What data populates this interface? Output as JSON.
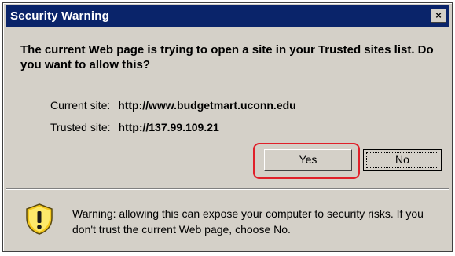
{
  "window": {
    "title": "Security Warning",
    "close_glyph": "×"
  },
  "dialog": {
    "question": "The current Web page is trying to open a site in your Trusted sites list. Do you want to allow this?",
    "current_site_label": "Current site:",
    "current_site_value": "http://www.budgetmart.uconn.edu",
    "trusted_site_label": "Trusted site:",
    "trusted_site_value": "http://137.99.109.21"
  },
  "buttons": {
    "yes_label": "Yes",
    "no_label": "No"
  },
  "warning": {
    "text": "Warning: allowing this can expose your computer to security risks. If you don't trust the current Web page, choose No."
  },
  "icons": {
    "warning": "shield-warning-icon",
    "close": "close-icon"
  },
  "colors": {
    "titlebar": "#0a246a",
    "dialog_bg": "#d4d0c8",
    "highlight": "#e0202a"
  }
}
